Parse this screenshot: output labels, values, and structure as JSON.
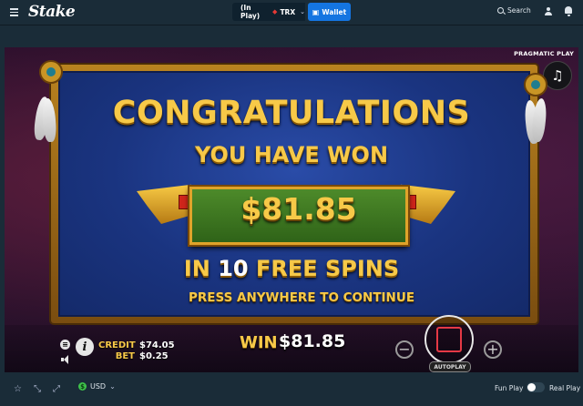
{
  "header": {
    "logo": "Stake",
    "balance_label": "(In Play)",
    "currency_code": "TRX",
    "wallet_label": "Wallet",
    "search_label": "Search"
  },
  "game": {
    "provider": "PRAGMATIC PLAY",
    "congrats": "CONGRATULATIONS",
    "you_have_won": "YOU HAVE WON",
    "win_amount": "$81.85",
    "free_spins_prefix": "IN",
    "free_spins_count": "10",
    "free_spins_suffix": "FREE SPINS",
    "continue_text": "PRESS ANYWHERE TO CONTINUE",
    "credit_label": "CREDIT",
    "credit_value": "$74.05",
    "bet_label": "BET",
    "bet_value": "$0.25",
    "win_label": "WIN",
    "win_value": "$81.85",
    "autoplay_label": "AUTOPLAY",
    "minus_symbol": "−",
    "plus_symbol": "+",
    "info_symbol": "i",
    "stop_color": "#e53945",
    "accent_gold": "#f7c948"
  },
  "footer": {
    "currency": "USD",
    "fun_play_label": "Fun Play",
    "real_play_label": "Real Play",
    "toggle_state": "fun"
  },
  "icons": [
    "menu-icon",
    "search-icon",
    "user-icon",
    "bell-icon",
    "trx-icon",
    "wallet-icon",
    "music-note-icon",
    "info-icon",
    "sound-icon",
    "star-icon",
    "stats-icon",
    "fullscreen-icon",
    "currency-icon",
    "chevron-down-icon",
    "stop-icon"
  ]
}
